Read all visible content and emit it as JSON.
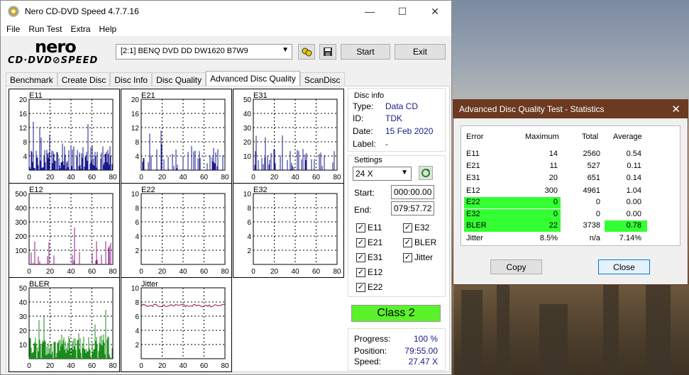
{
  "window": {
    "title": "Nero CD-DVD Speed 4.7.7.16",
    "minimize": "—",
    "maximize": "☐",
    "close": "✕"
  },
  "menu": [
    "File",
    "Run Test",
    "Extra",
    "Help"
  ],
  "logo": {
    "top": "nero",
    "bottom": "CD·DVD⊘SPEED"
  },
  "toolbar": {
    "drive": "[2:1]   BENQ DVD DD DW1620 B7W9",
    "start": "Start",
    "exit": "Exit"
  },
  "tabs": [
    "Benchmark",
    "Create Disc",
    "Disc Info",
    "Disc Quality",
    "Advanced Disc Quality",
    "ScanDisc"
  ],
  "charts": [
    {
      "name": "E11",
      "yticks": [
        "20",
        "16",
        "12",
        "8",
        "4"
      ],
      "xticks": [
        "0",
        "20",
        "40",
        "60",
        "80"
      ],
      "color": "#1a1a8c"
    },
    {
      "name": "E21",
      "yticks": [
        "20",
        "16",
        "12",
        "8",
        "4"
      ],
      "xticks": [
        "0",
        "20",
        "40",
        "60",
        "80"
      ],
      "color": "#1a1a8c"
    },
    {
      "name": "E31",
      "yticks": [
        "50",
        "40",
        "30",
        "20",
        "10"
      ],
      "xticks": [
        "0",
        "20",
        "40",
        "60",
        "80"
      ],
      "color": "#1a1a8c"
    },
    {
      "name": "E12",
      "yticks": [
        "500",
        "400",
        "300",
        "200",
        "100"
      ],
      "xticks": [
        "0",
        "20",
        "40",
        "60",
        "80"
      ],
      "color": "#8c1a8c"
    },
    {
      "name": "E22",
      "yticks": [
        "10",
        "8",
        "6",
        "4",
        "2"
      ],
      "xticks": [
        "0",
        "20",
        "40",
        "60",
        "80"
      ],
      "color": "#1a1a8c"
    },
    {
      "name": "E32",
      "yticks": [
        "10",
        "8",
        "6",
        "4",
        "2"
      ],
      "xticks": [
        "0",
        "20",
        "40",
        "60",
        "80"
      ],
      "color": "#1a1a8c"
    },
    {
      "name": "BLER",
      "yticks": [
        "50",
        "40",
        "30",
        "20",
        "10"
      ],
      "xticks": [
        "0",
        "20",
        "40",
        "60",
        "80"
      ],
      "color": "#1a8c1a"
    },
    {
      "name": "Jitter",
      "yticks": [
        "10",
        "8",
        "6",
        "4",
        "2"
      ],
      "xticks": [
        "0",
        "20",
        "40",
        "60",
        "80"
      ],
      "color": "#8c1a3a"
    }
  ],
  "disc_info": {
    "title": "Disc info",
    "type_label": "Type:",
    "type": "Data CD",
    "id_label": "ID:",
    "id": "TDK",
    "date_label": "Date:",
    "date": "15 Feb 2020",
    "label_label": "Label:",
    "label": "-"
  },
  "settings": {
    "title": "Settings",
    "speed": "24 X",
    "start_label": "Start:",
    "start": "000:00.00",
    "end_label": "End:",
    "end": "079:57.72"
  },
  "checks": [
    "E11",
    "E32",
    "E21",
    "BLER",
    "E31",
    "Jitter",
    "E12",
    "E22"
  ],
  "class_label": "Class 2",
  "progress": {
    "progress_label": "Progress:",
    "progress": "100 %",
    "position_label": "Position:",
    "position": "79:55.00",
    "speed_label": "Speed:",
    "speed": "27.47 X"
  },
  "dialog": {
    "title": "Advanced Disc Quality Test - Statistics",
    "close": "✕",
    "headers": [
      "Error",
      "Maximum",
      "Total",
      "Average"
    ],
    "rows": [
      {
        "error": "E11",
        "max": "14",
        "total": "2560",
        "avg": "0.54"
      },
      {
        "error": "E21",
        "max": "11",
        "total": "527",
        "avg": "0.11"
      },
      {
        "error": "E31",
        "max": "20",
        "total": "651",
        "avg": "0.14"
      },
      {
        "error": "E12",
        "max": "300",
        "total": "4961",
        "avg": "1.04"
      },
      {
        "error": "E22",
        "max": "0",
        "total": "0",
        "avg": "0.00"
      },
      {
        "error": "E32",
        "max": "0",
        "total": "0",
        "avg": "0.00"
      },
      {
        "error": "BLER",
        "max": "22",
        "total": "3738",
        "avg": "0.78"
      },
      {
        "error": "Jitter",
        "max": "8.5%",
        "total": "n/a",
        "avg": "7.14%"
      }
    ],
    "copy": "Copy",
    "close_btn": "Close",
    "highlight": "#33ff33",
    "highlight_bler": "#99ff33"
  }
}
